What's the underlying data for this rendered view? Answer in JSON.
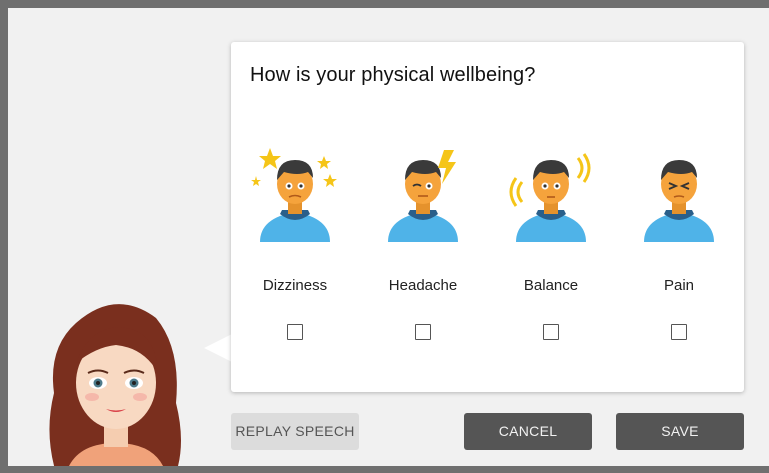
{
  "question": "How is your physical wellbeing?",
  "options": [
    {
      "label": "Dizziness",
      "icon": "dizzy-person-icon",
      "checked": false
    },
    {
      "label": "Headache",
      "icon": "headache-person-icon",
      "checked": false
    },
    {
      "label": "Balance",
      "icon": "balance-person-icon",
      "checked": false
    },
    {
      "label": "Pain",
      "icon": "pain-person-icon",
      "checked": false
    }
  ],
  "buttons": {
    "replay": "REPLAY SPEECH",
    "cancel": "CANCEL",
    "save": "SAVE"
  },
  "colors": {
    "frame": "#6f6f6f",
    "background": "#f1f1f1",
    "button_dark": "#555555",
    "button_light": "#dcdcdc",
    "skin": "#f5a33c",
    "shirt": "#4fb3e8",
    "hair": "#3a3a3a",
    "accent_star": "#f5c518"
  }
}
